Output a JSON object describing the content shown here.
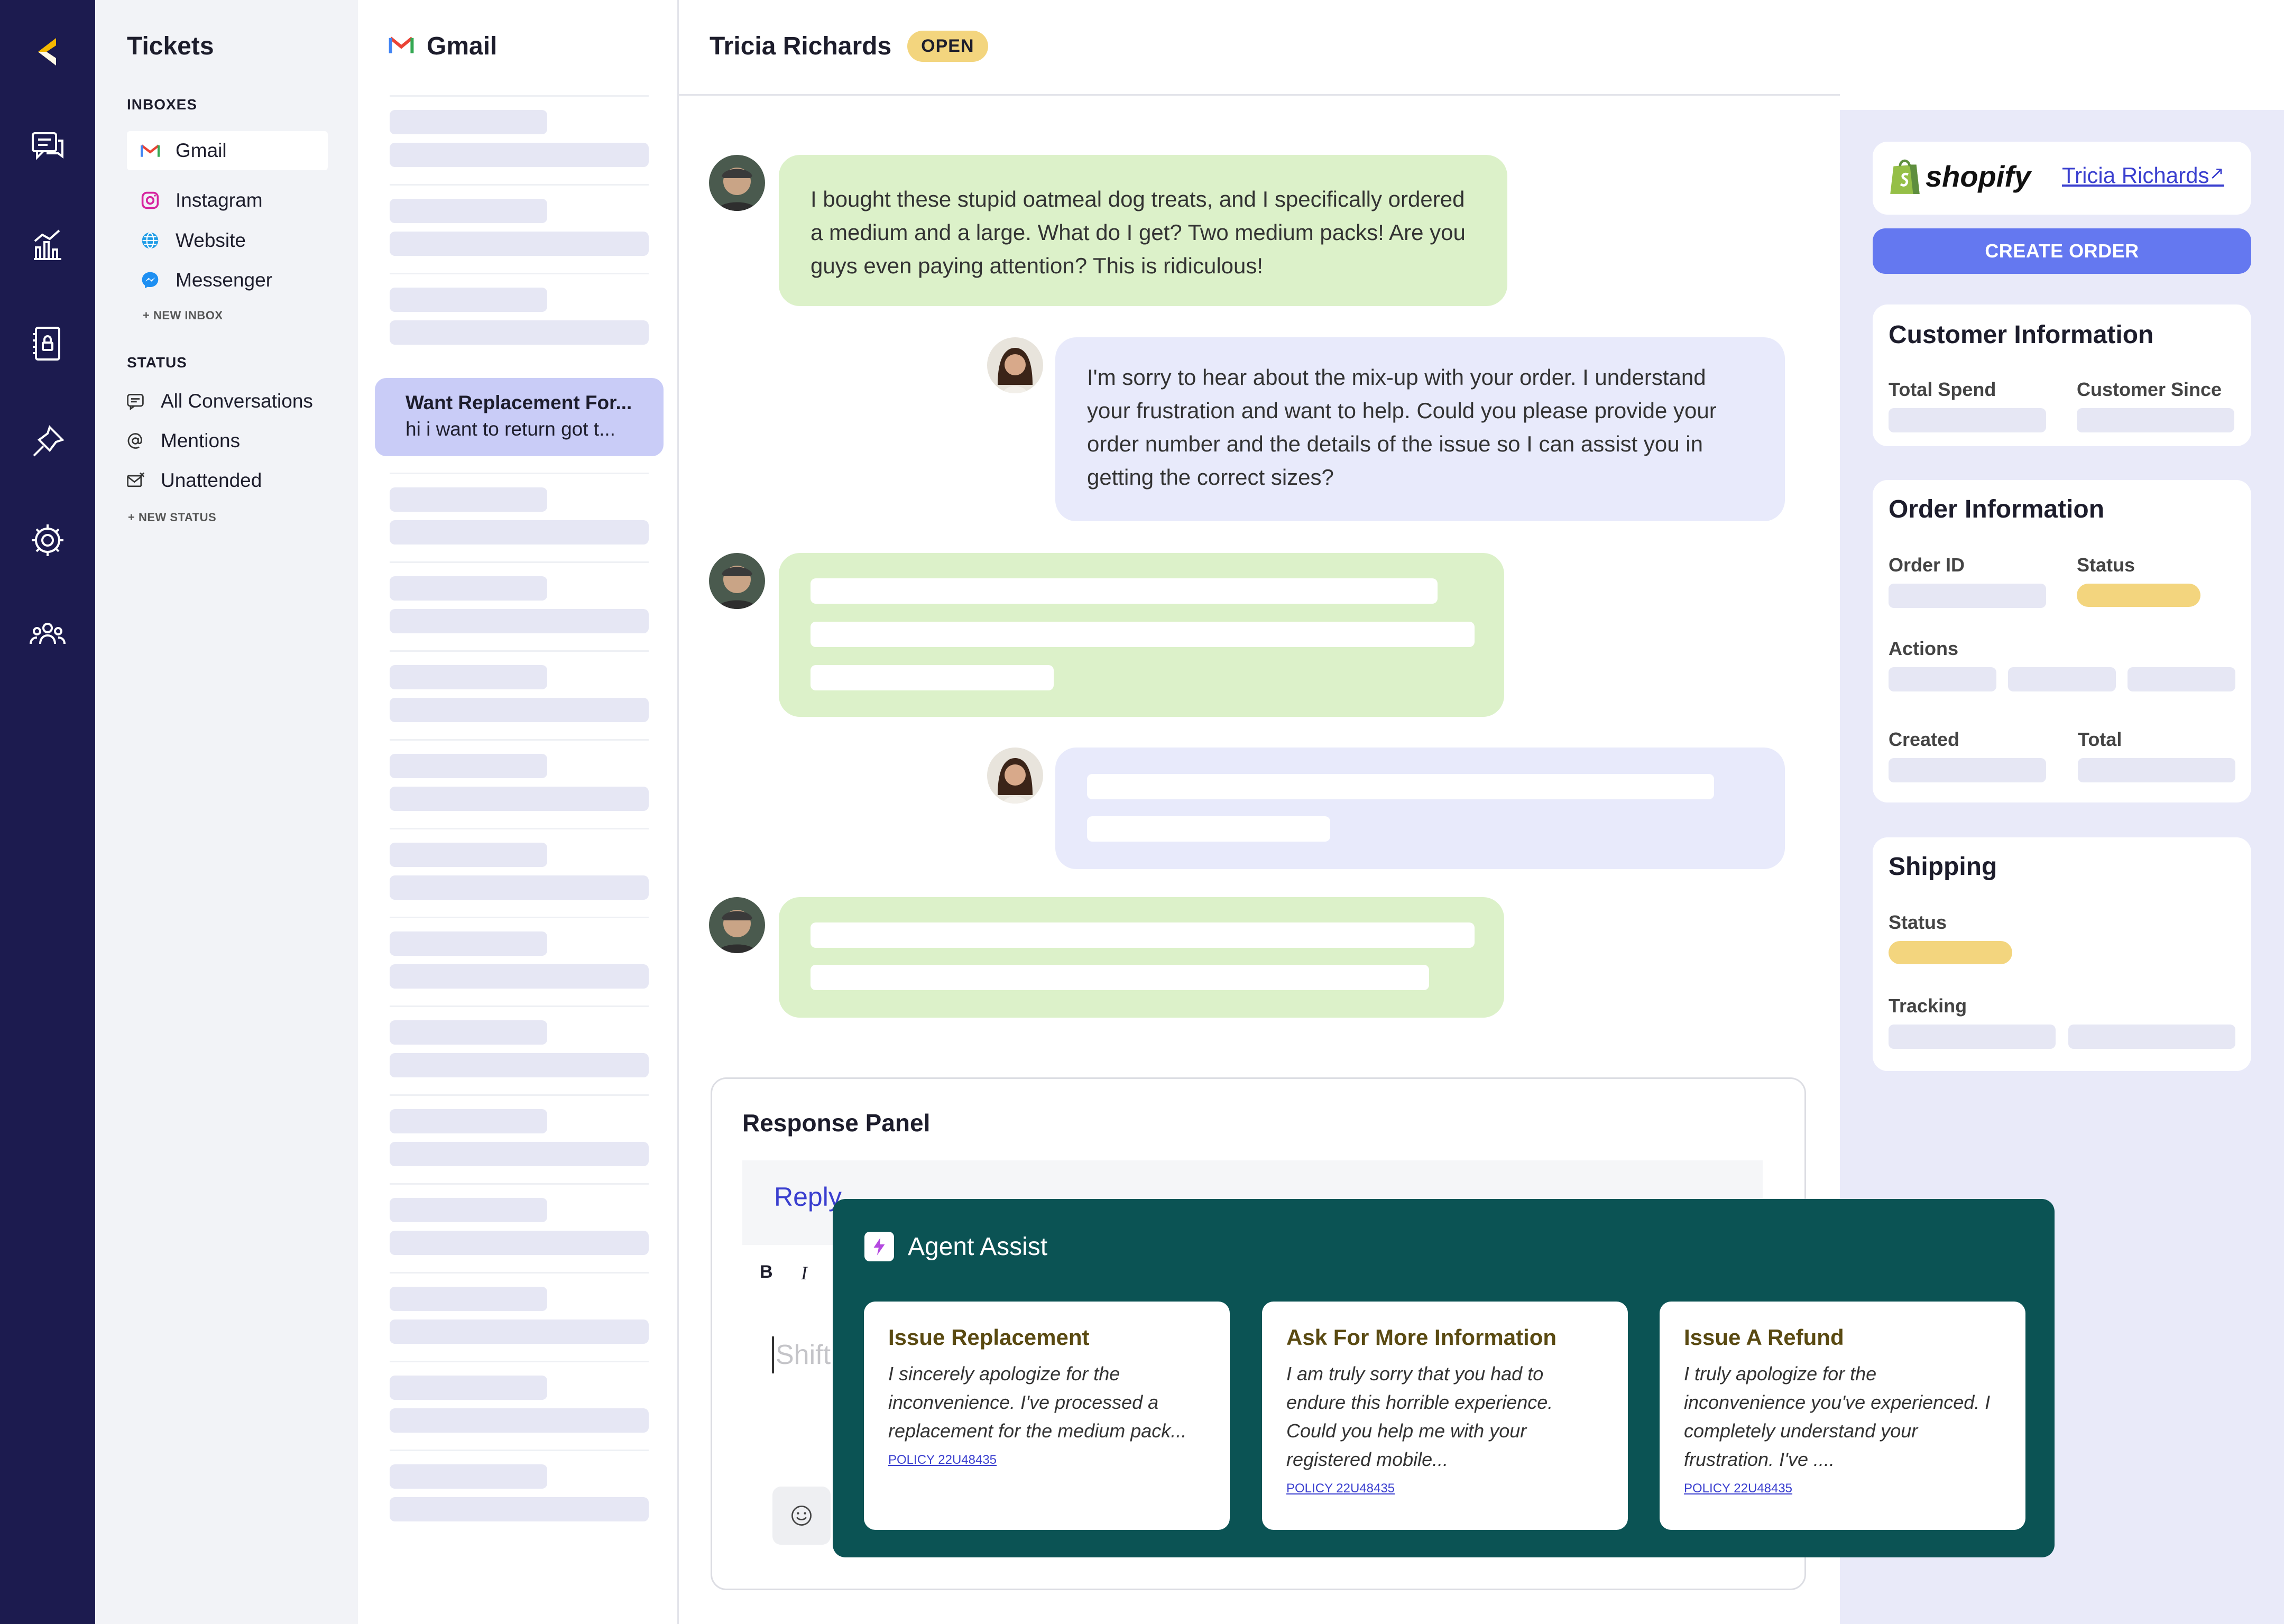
{
  "nav": {
    "title": "Tickets",
    "inboxes_heading": "INBOXES",
    "inboxes": [
      {
        "label": "Gmail",
        "icon": "gmail-icon"
      },
      {
        "label": "Instagram",
        "icon": "instagram-icon"
      },
      {
        "label": "Website",
        "icon": "globe-icon"
      },
      {
        "label": "Messenger",
        "icon": "messenger-icon"
      }
    ],
    "new_inbox": "+ NEW INBOX",
    "status_heading": "STATUS",
    "statuses": [
      {
        "label": "All Conversations",
        "icon": "chat-icon"
      },
      {
        "label": "Mentions",
        "icon": "at-icon"
      },
      {
        "label": "Unattended",
        "icon": "envelope-icon"
      }
    ],
    "new_status": "+ NEW STATUS"
  },
  "list": {
    "title": "Gmail",
    "selected": {
      "subject": "Want Replacement For...",
      "preview": "hi i want to return got t..."
    }
  },
  "conversation": {
    "customer_name": "Tricia Richards",
    "status_badge": "OPEN",
    "messages": [
      {
        "from": "customer",
        "text": "I bought these stupid oatmeal dog treats, and I specifically ordered a medium and a large. What do I get? Two medium packs! Are you guys even paying attention? This is ridiculous!"
      },
      {
        "from": "agent",
        "text": "I'm sorry to hear about the mix-up with your order. I understand your frustration and want to help. Could you please provide your order number and the details of the issue so I can assist you in getting the correct sizes?"
      }
    ]
  },
  "response_panel": {
    "title": "Response Panel",
    "reply_tab": "Reply",
    "bold": "B",
    "italic": "I",
    "placeholder": "Shift"
  },
  "agent_assist": {
    "title": "Agent Assist",
    "suggestions": [
      {
        "title": "Issue Replacement",
        "text": "I sincerely apologize for the inconvenience. I've processed a replacement for the medium pack...",
        "policy": "POLICY 22U48435"
      },
      {
        "title": "Ask For More Information",
        "text": "I am truly sorry that you had to endure this horrible experience. Could you help me with your registered mobile...",
        "policy": "POLICY 22U48435"
      },
      {
        "title": "Issue A Refund",
        "text": "I truly apologize for the inconvenience you've experienced. I completely understand your frustration. I've ....",
        "policy": "POLICY 22U48435"
      }
    ]
  },
  "sidebar": {
    "shopify_label": "shopify",
    "customer_link": "Tricia Richards",
    "create_order": "CREATE ORDER",
    "customer_info": {
      "title": "Customer Information",
      "total_spend": "Total Spend",
      "customer_since": "Customer Since"
    },
    "order_info": {
      "title": "Order Information",
      "order_id": "Order ID",
      "status": "Status",
      "actions": "Actions",
      "created": "Created",
      "total": "Total"
    },
    "shipping": {
      "title": "Shipping",
      "status": "Status",
      "tracking": "Tracking"
    }
  },
  "colors": {
    "rail": "#1c1b4f",
    "accent": "#6478f0",
    "customer_bubble": "#dcf1c9",
    "agent_bubble": "#e8eafb",
    "assist_bg": "#0b5354",
    "badge": "#f3d57e"
  }
}
